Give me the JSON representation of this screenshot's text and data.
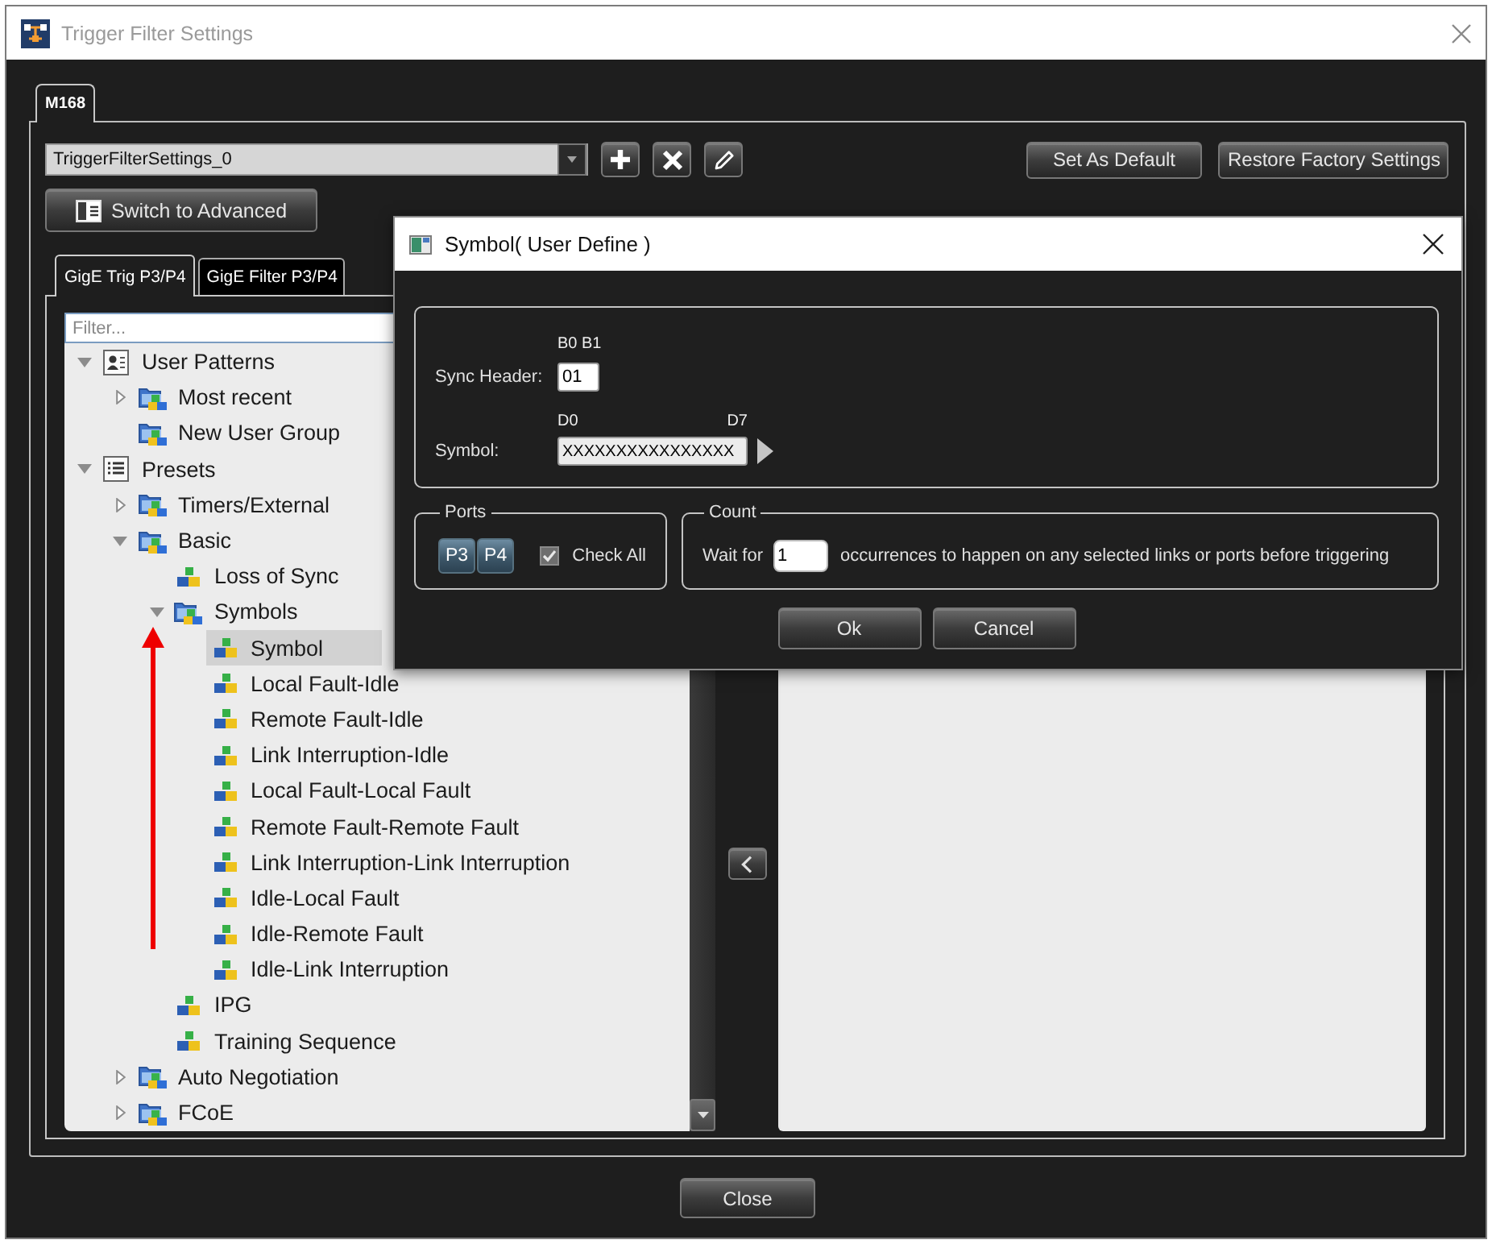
{
  "window": {
    "title": "Trigger Filter Settings"
  },
  "device_tabs": [
    {
      "label": "M168",
      "selected": true
    }
  ],
  "toolbar": {
    "preset": {
      "value": "TriggerFilterSettings_0"
    },
    "actions": [
      "Set As Default",
      "Restore Factory Settings"
    ],
    "mode_button": "Switch to Advanced"
  },
  "protocol_tabs": [
    {
      "label": "GigE Trig P3/P4",
      "selected": true
    },
    {
      "label": "GigE Filter P3/P4",
      "selected": false
    }
  ],
  "tree": {
    "filter": {
      "placeholder": "Filter..."
    },
    "items": [
      {
        "label": "User Patterns",
        "kind": "people",
        "expanded": true,
        "selected": false,
        "children": [
          {
            "label": "Most recent",
            "kind": "folder",
            "expanded": false,
            "selected": false
          },
          {
            "label": "New User Group",
            "kind": "folder",
            "selected": false
          }
        ]
      },
      {
        "label": "Presets",
        "kind": "list",
        "expanded": true,
        "selected": false,
        "children": [
          {
            "label": "Timers/External",
            "kind": "folder",
            "expanded": false,
            "selected": false
          },
          {
            "label": "Basic",
            "kind": "folder",
            "expanded": true,
            "selected": false,
            "children": [
              {
                "label": "Loss of Sync",
                "kind": "pattern",
                "selected": false
              },
              {
                "label": "Symbols",
                "kind": "folder",
                "expanded": true,
                "selected": false,
                "children": [
                  {
                    "label": "Symbol",
                    "kind": "pattern",
                    "selected": true
                  },
                  {
                    "label": "Local Fault-Idle",
                    "kind": "pattern",
                    "selected": false
                  },
                  {
                    "label": "Remote Fault-Idle",
                    "kind": "pattern",
                    "selected": false
                  },
                  {
                    "label": "Link Interruption-Idle",
                    "kind": "pattern",
                    "selected": false
                  },
                  {
                    "label": "Local Fault-Local Fault",
                    "kind": "pattern",
                    "selected": false
                  },
                  {
                    "label": "Remote Fault-Remote Fault",
                    "kind": "pattern",
                    "selected": false
                  },
                  {
                    "label": "Link Interruption-Link Interruption",
                    "kind": "pattern",
                    "selected": false
                  },
                  {
                    "label": "Idle-Local Fault",
                    "kind": "pattern",
                    "selected": false
                  },
                  {
                    "label": "Idle-Remote Fault",
                    "kind": "pattern",
                    "selected": false
                  },
                  {
                    "label": "Idle-Link Interruption",
                    "kind": "pattern",
                    "selected": false
                  }
                ]
              },
              {
                "label": "IPG",
                "kind": "pattern",
                "selected": false
              },
              {
                "label": "Training Sequence",
                "kind": "pattern",
                "selected": false
              }
            ]
          },
          {
            "label": "Auto Negotiation",
            "kind": "folder",
            "expanded": false,
            "selected": false
          },
          {
            "label": "FCoE",
            "kind": "folder",
            "expanded": false,
            "selected": false
          }
        ]
      }
    ]
  },
  "dialog": {
    "title": "Symbol( User Define )",
    "pattern": {
      "header_bits": "B0 B1",
      "header_label": "Sync Header:",
      "header_value": "01",
      "symbol_start": "D0",
      "symbol_end": "D7",
      "symbol_label": "Symbol:",
      "symbol_value": "XXXXXXXXXXXXXXXX"
    },
    "ports": {
      "legend": "Ports",
      "buttons": [
        {
          "label": "P3",
          "on": true
        },
        {
          "label": "P4",
          "on": true
        }
      ],
      "check_all": {
        "label": "Check All",
        "checked": true
      }
    },
    "count": {
      "legend": "Count",
      "prefix": "Wait for",
      "value": "1",
      "suffix": "occurrences to happen on any selected links or ports before triggering"
    },
    "buttons": [
      "Ok",
      "Cancel"
    ]
  },
  "close_button": "Close"
}
